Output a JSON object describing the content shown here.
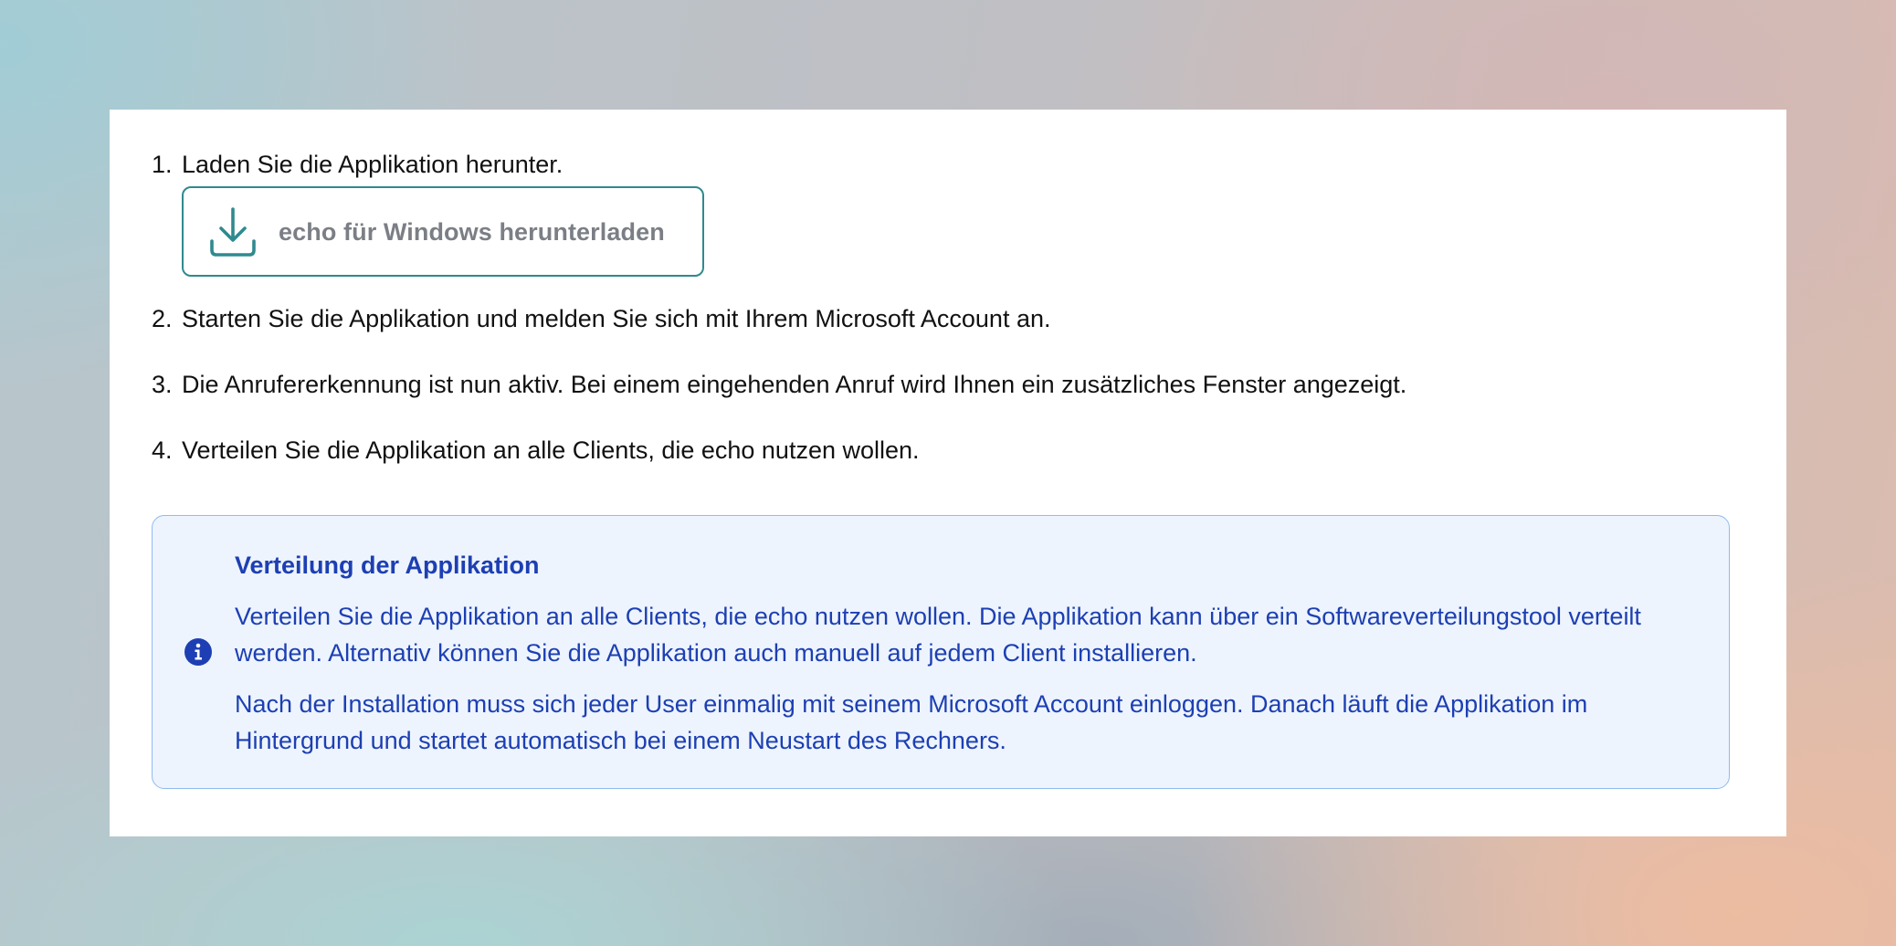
{
  "steps": [
    {
      "number": "1.",
      "text": "Laden Sie die Applikation herunter."
    },
    {
      "number": "2.",
      "text": "Starten Sie die Applikation und melden Sie sich mit Ihrem Microsoft Account an."
    },
    {
      "number": "3.",
      "text": "Die Anrufererkennung ist nun aktiv. Bei einem eingehenden Anruf wird Ihnen ein zusätzliches Fenster angezeigt."
    },
    {
      "number": "4.",
      "text": "Verteilen Sie die Applikation an alle Clients, die echo nutzen wollen."
    }
  ],
  "download": {
    "label": "echo für Windows herunterladen",
    "icon": "download-icon"
  },
  "info": {
    "icon": "info-icon",
    "title": "Verteilung der Applikation",
    "paragraphs": [
      "Verteilen Sie die Applikation an alle Clients, die echo nutzen wollen. Die Applikation kann über ein Softwareverteilungstool verteilt werden. Alternativ können Sie die Applikation auch manuell auf jedem Client installieren.",
      "Nach der Installation muss sich jeder User einmalig mit seinem Microsoft Account einloggen. Danach läuft die Applikation im Hintergrund und startet automatisch bei einem Neustart des Rechners."
    ]
  },
  "colors": {
    "accent": "#2f8a8f",
    "info_text": "#1d3fb3",
    "info_background": "#edf4fd",
    "info_border": "#8dbcf0"
  }
}
